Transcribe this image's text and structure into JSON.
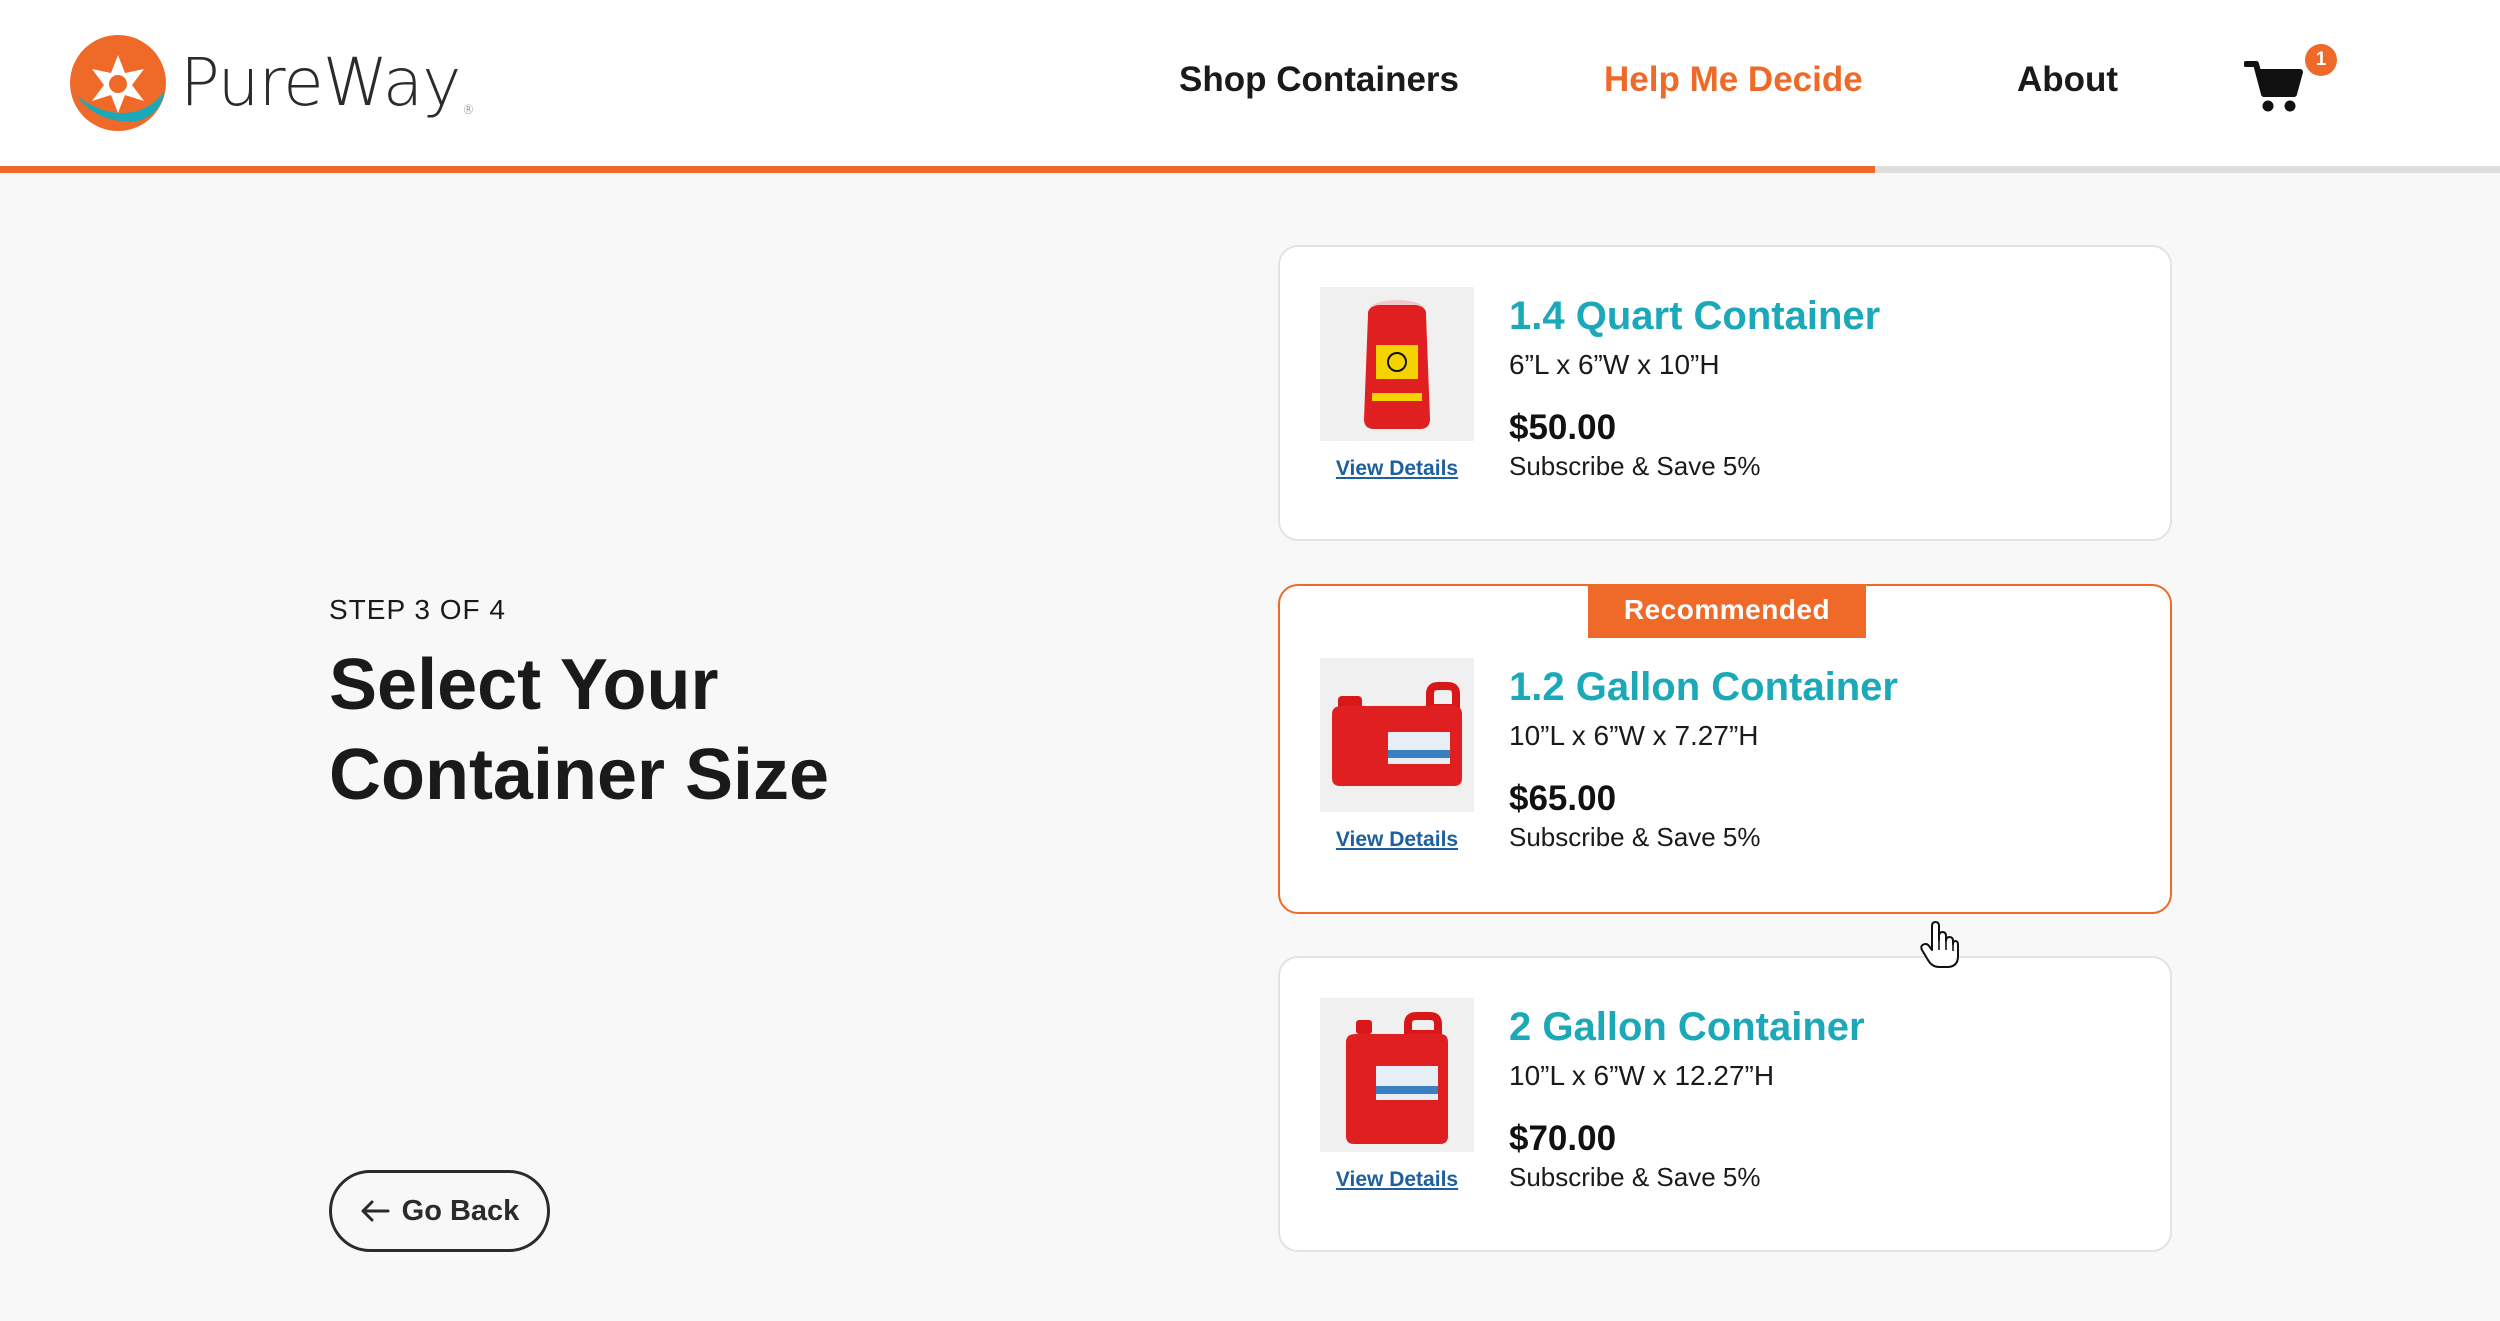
{
  "header": {
    "logo_text": "PureWay",
    "logo_mark": "®",
    "nav": {
      "shop": "Shop Containers",
      "help": "Help Me Decide",
      "about": "About"
    },
    "cart_icon": "shopping-cart-icon",
    "cart_count": "1",
    "progress_fraction": 0.75
  },
  "left": {
    "step": "STEP 3 OF 4",
    "title": "Select Your Container Size",
    "go_back": "Go Back",
    "go_back_icon": "arrow-left-icon"
  },
  "containers": [
    {
      "name": "1.4 Quart Container",
      "dims": "6”L x 6”W x 10”H",
      "price": "$50.00",
      "subscribe": "Subscribe & Save 5%",
      "view_details": "View Details",
      "recommended": false
    },
    {
      "name": "1.2 Gallon Container",
      "dims": "10”L x 6”W x 7.27”H",
      "price": "$65.00",
      "subscribe": "Subscribe & Save 5%",
      "view_details": "View Details",
      "recommended": true,
      "badge": "Recommended"
    },
    {
      "name": "2 Gallon Container",
      "dims": "10”L x 6”W x 12.27”H",
      "price": "$70.00",
      "subscribe": "Subscribe & Save 5%",
      "view_details": "View Details",
      "recommended": false
    }
  ],
  "colors": {
    "accent": "#ef6a28",
    "teal": "#1ba8b8",
    "link": "#1e5fa0"
  }
}
